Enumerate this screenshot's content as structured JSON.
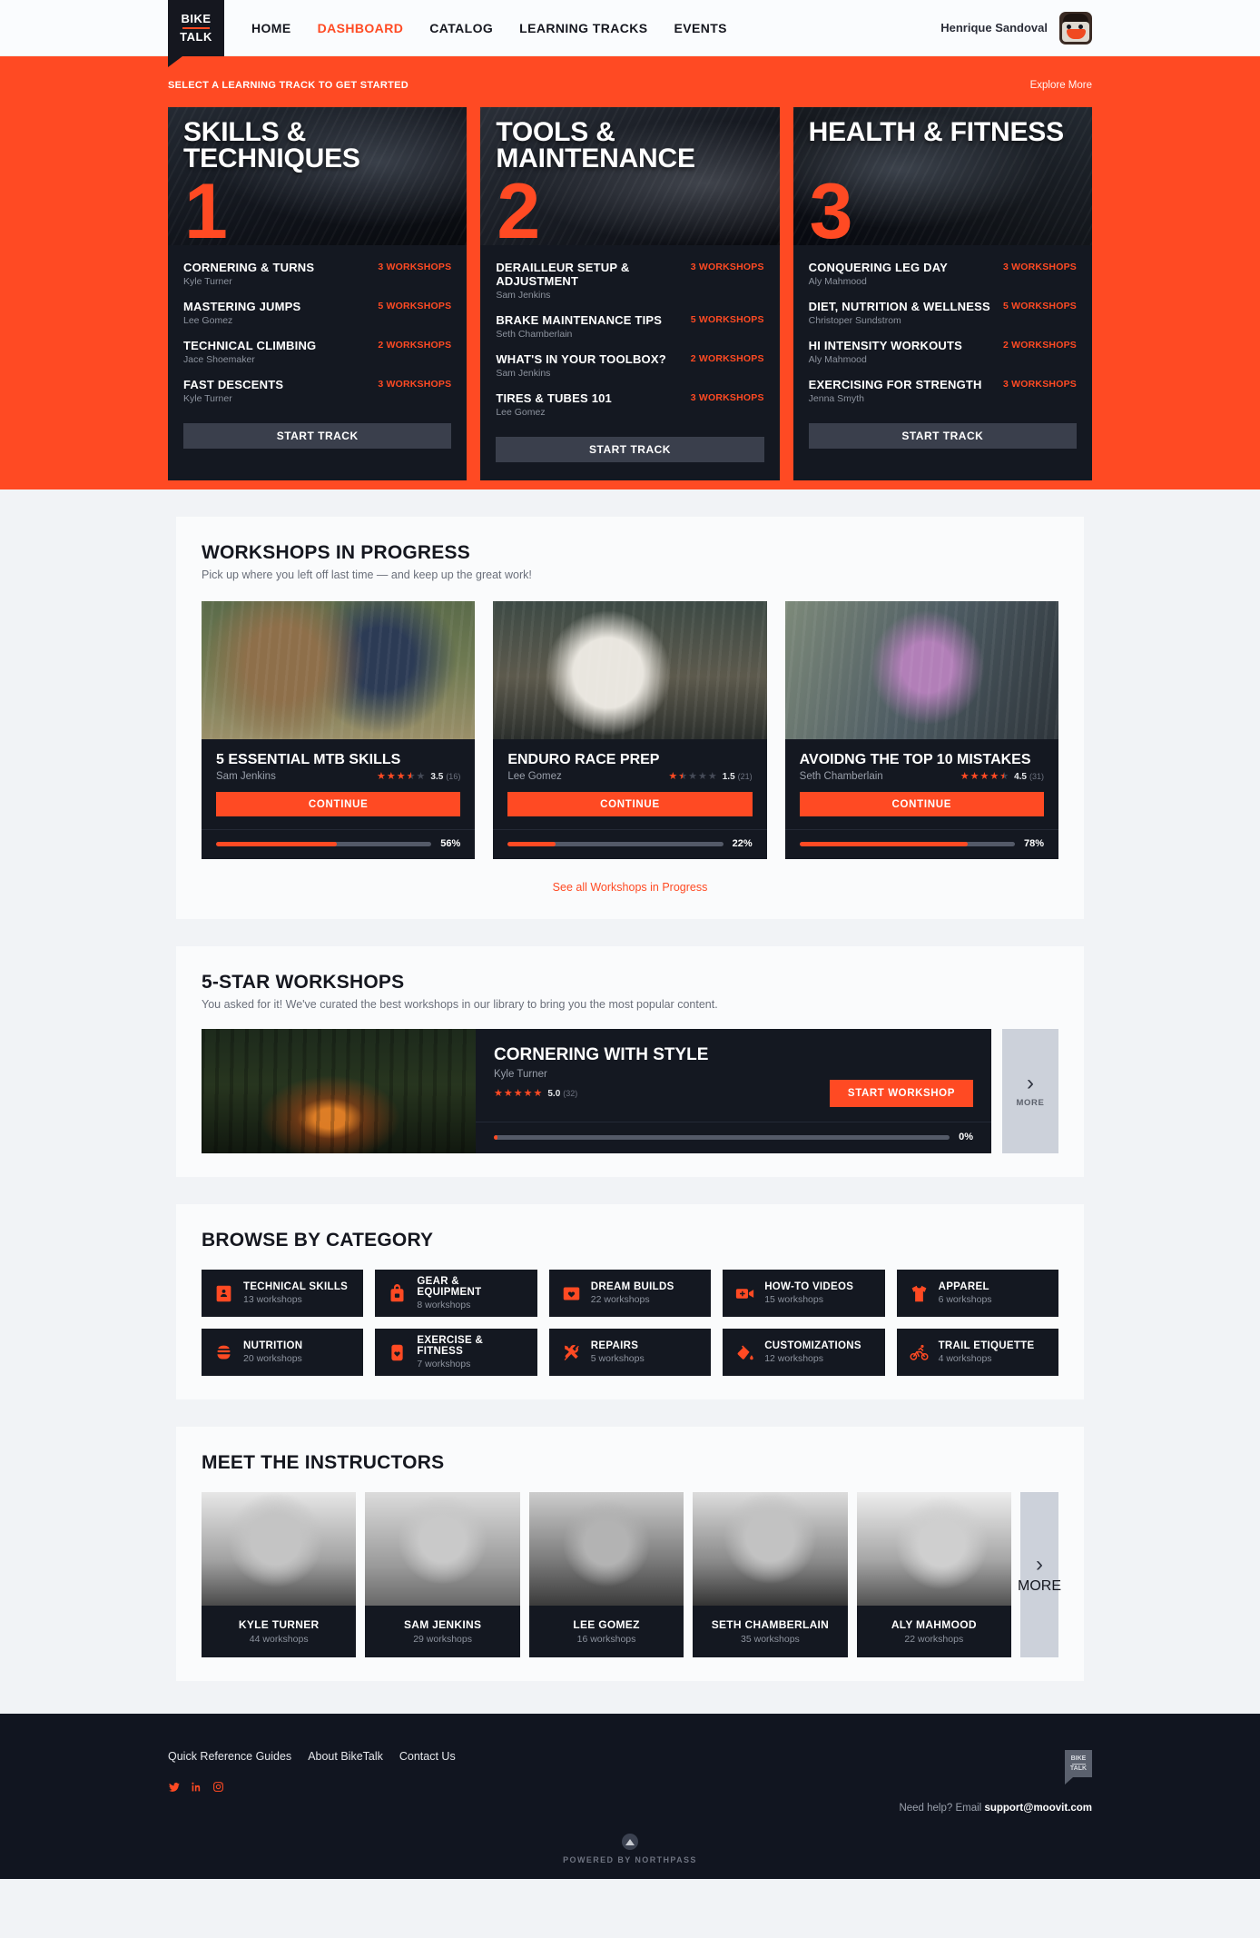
{
  "brand": {
    "line1": "BIKE",
    "line2": "TALK",
    "accent": "#ff4a23",
    "dark": "#141821"
  },
  "nav": {
    "items": [
      {
        "label": "HOME",
        "active": false
      },
      {
        "label": "DASHBOARD",
        "active": true
      },
      {
        "label": "CATALOG",
        "active": false
      },
      {
        "label": "LEARNING TRACKS",
        "active": false
      },
      {
        "label": "EVENTS",
        "active": false
      }
    ],
    "user_name": "Henrique Sandoval"
  },
  "hero": {
    "title": "SELECT A LEARNING TRACK TO GET STARTED",
    "explore_label": "Explore More",
    "tracks": [
      {
        "title": "SKILLS & TECHNIQUES",
        "number": "1",
        "button": "START TRACK",
        "items": [
          {
            "title": "CORNERING & TURNS",
            "author": "Kyle Turner",
            "count": "3 WORKSHOPS"
          },
          {
            "title": "MASTERING JUMPS",
            "author": "Lee Gomez",
            "count": "5 WORKSHOPS"
          },
          {
            "title": "TECHNICAL CLIMBING",
            "author": "Jace Shoemaker",
            "count": "2 WORKSHOPS"
          },
          {
            "title": "FAST DESCENTS",
            "author": "Kyle Turner",
            "count": "3 WORKSHOPS"
          }
        ]
      },
      {
        "title": "TOOLS & MAINTENANCE",
        "number": "2",
        "button": "START TRACK",
        "items": [
          {
            "title": "DERAILLEUR SETUP & ADJUSTMENT",
            "author": "Sam Jenkins",
            "count": "3 WORKSHOPS"
          },
          {
            "title": "BRAKE MAINTENANCE TIPS",
            "author": "Seth Chamberlain",
            "count": "5 WORKSHOPS"
          },
          {
            "title": "WHAT'S IN YOUR TOOLBOX?",
            "author": "Sam Jenkins",
            "count": "2 WORKSHOPS"
          },
          {
            "title": "TIRES & TUBES 101",
            "author": "Lee Gomez",
            "count": "3 WORKSHOPS"
          }
        ]
      },
      {
        "title": "HEALTH & FITNESS",
        "number": "3",
        "button": "START TRACK",
        "items": [
          {
            "title": "CONQUERING LEG DAY",
            "author": "Aly Mahmood",
            "count": "3 WORKSHOPS"
          },
          {
            "title": "DIET, NUTRITION & WELLNESS",
            "author": "Christoper Sundstrom",
            "count": "5 WORKSHOPS"
          },
          {
            "title": "HI INTENSITY WORKOUTS",
            "author": "Aly Mahmood",
            "count": "2 WORKSHOPS"
          },
          {
            "title": "EXERCISING FOR STRENGTH",
            "author": "Jenna Smyth",
            "count": "3 WORKSHOPS"
          }
        ]
      }
    ]
  },
  "in_progress": {
    "heading": "WORKSHOPS IN PROGRESS",
    "subheading": "Pick up where you left off last time — and keep up the great work!",
    "see_all": "See all Workshops in Progress",
    "cards": [
      {
        "title": "5 ESSENTIAL MTB SKILLS",
        "author": "Sam Jenkins",
        "rating": "3.5",
        "rating_count": "(16)",
        "cta": "CONTINUE",
        "progress": "56%"
      },
      {
        "title": "ENDURO RACE PREP",
        "author": "Lee Gomez",
        "rating": "1.5",
        "rating_count": "(21)",
        "cta": "CONTINUE",
        "progress": "22%"
      },
      {
        "title": "AVOIDNG THE TOP 10 MISTAKES",
        "author": "Seth Chamberlain",
        "rating": "4.5",
        "rating_count": "(31)",
        "cta": "CONTINUE",
        "progress": "78%"
      }
    ]
  },
  "five_star": {
    "heading": "5-STAR WORKSHOPS",
    "subheading": "You asked for it! We've curated the best workshops in our library to bring you the most popular content.",
    "card": {
      "title": "CORNERING WITH STYLE",
      "author": "Kyle Turner",
      "rating": "5.0",
      "rating_count": "(32)",
      "cta": "START WORKSHOP",
      "progress": "0%"
    },
    "more_label": "MORE"
  },
  "categories": {
    "heading": "BROWSE BY CATEGORY",
    "items": [
      {
        "name": "TECHNICAL SKILLS",
        "count": "13 workshops",
        "icon": "book-icon"
      },
      {
        "name": "GEAR & EQUIPMENT",
        "count": "8 workshops",
        "icon": "backpack-icon"
      },
      {
        "name": "DREAM BUILDS",
        "count": "22 workshops",
        "icon": "heart-box-icon"
      },
      {
        "name": "HOW-TO VIDEOS",
        "count": "15 workshops",
        "icon": "video-camera-icon"
      },
      {
        "name": "APPAREL",
        "count": "6 workshops",
        "icon": "tshirt-icon"
      },
      {
        "name": "NUTRITION",
        "count": "20 workshops",
        "icon": "burger-icon"
      },
      {
        "name": "EXERCISE & FITNESS",
        "count": "7 workshops",
        "icon": "heart-monitor-icon"
      },
      {
        "name": "REPAIRS",
        "count": "5 workshops",
        "icon": "tools-icon"
      },
      {
        "name": "CUSTOMIZATIONS",
        "count": "12 workshops",
        "icon": "paint-bucket-icon"
      },
      {
        "name": "TRAIL ETIQUETTE",
        "count": "4 workshops",
        "icon": "cyclist-icon"
      }
    ]
  },
  "instructors": {
    "heading": "MEET THE INSTRUCTORS",
    "more_label": "MORE",
    "items": [
      {
        "name": "KYLE TURNER",
        "count": "44 workshops"
      },
      {
        "name": "SAM JENKINS",
        "count": "29 workshops"
      },
      {
        "name": "LEE GOMEZ",
        "count": "16 workshops"
      },
      {
        "name": "SETH CHAMBERLAIN",
        "count": "35 workshops"
      },
      {
        "name": "ALY MAHMOOD",
        "count": "22 workshops"
      }
    ]
  },
  "footer": {
    "links": [
      "Quick Reference Guides",
      "About BikeTalk",
      "Contact Us"
    ],
    "social": [
      "twitter-icon",
      "linkedin-icon",
      "instagram-icon"
    ],
    "help_prefix": "Need help? Email ",
    "help_email": "support@moovit.com",
    "powered": "POWERED BY NORTHPASS",
    "logo_line1": "BIKE",
    "logo_line2": "TALK"
  }
}
